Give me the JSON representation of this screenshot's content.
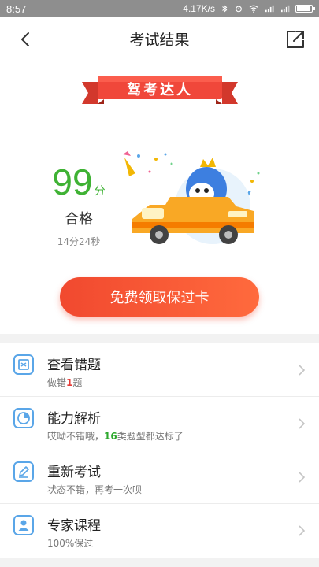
{
  "status_bar": {
    "time": "8:57",
    "network_speed": "4.17K/s"
  },
  "header": {
    "title": "考试结果"
  },
  "badge": {
    "text": "驾考达人"
  },
  "score": {
    "value": "99",
    "unit": "分",
    "status": "合格",
    "time_used": "14分24秒"
  },
  "cta": {
    "label": "免费领取保过卡"
  },
  "menu": [
    {
      "title": "查看错题",
      "sub_pre": "做错",
      "sub_hl": "1",
      "sub_post": "题",
      "icon": "document-icon"
    },
    {
      "title": "能力解析",
      "sub_pre": "哎呦不错哦，",
      "sub_hl": "16",
      "sub_post": "类题型都达标了",
      "icon": "pie-chart-icon"
    },
    {
      "title": "重新考试",
      "sub_text": "状态不错，再考一次呗",
      "icon": "edit-icon"
    },
    {
      "title": "专家课程",
      "sub_text": "100%保过",
      "icon": "user-icon"
    }
  ],
  "colors": {
    "accent": "#f1492f",
    "score_green": "#3fb234",
    "icon_blue": "#5aa6e8"
  }
}
